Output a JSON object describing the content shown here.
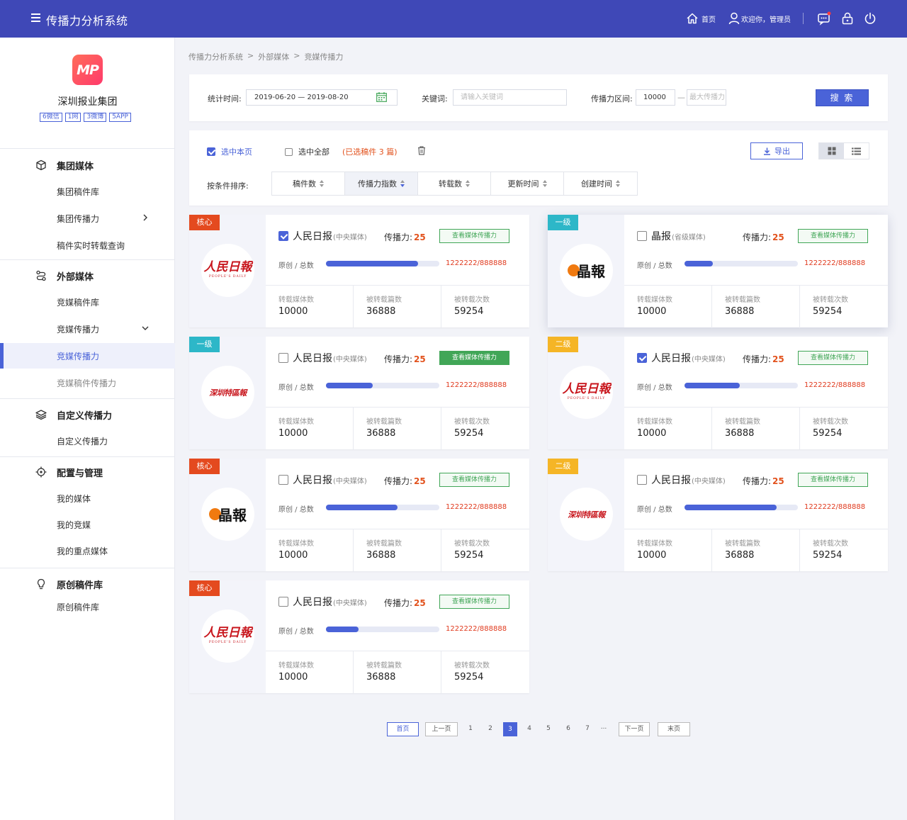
{
  "header": {
    "title": "传播力分析系统",
    "home": "首页",
    "welcome": "欢迎你，管理员"
  },
  "sidebar": {
    "org_name": "深圳报业集团",
    "logo_text": "MP",
    "tags": [
      "6微信",
      "1网",
      "3微博",
      "5APP"
    ],
    "groups": [
      {
        "title": "集团媒体",
        "icon": "cube-icon",
        "items": [
          "集团稿件库",
          "集团传播力",
          "稿件实时转载查询"
        ]
      },
      {
        "title": "外部媒体",
        "icon": "route-icon",
        "items": [
          "竞媒稿件库",
          "竞媒传播力",
          "竞媒传播力",
          "竞媒稿件传播力"
        ]
      },
      {
        "title": "自定义传播力",
        "icon": "layers-icon",
        "items": [
          "自定义传播力"
        ]
      },
      {
        "title": "配置与管理",
        "icon": "target-icon",
        "items": [
          "我的媒体",
          "我的竞媒",
          "我的重点媒体"
        ]
      },
      {
        "title": "原创稿件库",
        "icon": "bulb-icon",
        "items": [
          "原创稿件库"
        ]
      }
    ]
  },
  "breadcrumb": [
    "传播力分析系统",
    "外部媒体",
    "竞媒传播力"
  ],
  "filters": {
    "date_label": "统计时间:",
    "date_value": "2019-06-20 — 2019-08-20",
    "keyword_label": "关键词:",
    "keyword_placeholder": "请输入关键词",
    "range_label": "传播力区间:",
    "range_min": "10000",
    "range_dash": "—",
    "range_max_placeholder": "最大传播力",
    "search_label": "搜 索"
  },
  "toolbar": {
    "select_page": "选中本页",
    "select_all": "选中全部",
    "selected_count": "(已选稿件 3 篇)",
    "export_label": "导出",
    "sort_label": "按条件排序:",
    "sort_options": [
      "稿件数",
      "传播力指数",
      "转载数",
      "更新时间",
      "创建时间"
    ]
  },
  "card_labels": {
    "power": "传播力:",
    "view_btn": "查看媒体传播力",
    "ratio": "原创 / 总数",
    "stat_keys": [
      "转载媒体数",
      "被转载篇数",
      "被转载次数"
    ]
  },
  "cards": [
    {
      "badge": "核心",
      "badge_color": "#e44a1f",
      "logo": "rmrb",
      "checked": true,
      "name": "人民日报",
      "type": "(中央媒体)",
      "power": "25",
      "ratio": "1222222/888888",
      "fill": 0.81,
      "stats": [
        "10000",
        "36888",
        "59254"
      ],
      "btn_solid": false
    },
    {
      "badge": "一级",
      "badge_color": "#2db7c8",
      "logo": "jingbao",
      "checked": false,
      "name": "晶报",
      "type": "(省级媒体)",
      "power": "25",
      "ratio": "1222222/888888",
      "fill": 0.25,
      "stats": [
        "10000",
        "36888",
        "59254"
      ],
      "btn_solid": false
    },
    {
      "badge": "一级",
      "badge_color": "#2db7c8",
      "logo": "sztq",
      "checked": false,
      "name": "人民日报",
      "type": "(中央媒体)",
      "power": "25",
      "ratio": "1222222/888888",
      "fill": 0.41,
      "stats": [
        "10000",
        "36888",
        "59254"
      ],
      "btn_solid": true
    },
    {
      "badge": "二级",
      "badge_color": "#f5b526",
      "logo": "rmrb",
      "checked": true,
      "name": "人民日报",
      "type": "(中央媒体)",
      "power": "25",
      "ratio": "1222222/888888",
      "fill": 0.49,
      "stats": [
        "10000",
        "36888",
        "59254"
      ],
      "btn_solid": false
    },
    {
      "badge": "核心",
      "badge_color": "#e44a1f",
      "logo": "jingbao",
      "checked": false,
      "name": "人民日报",
      "type": "(中央媒体)",
      "power": "25",
      "ratio": "1222222/888888",
      "fill": 0.63,
      "stats": [
        "10000",
        "36888",
        "59254"
      ],
      "btn_solid": false
    },
    {
      "badge": "二级",
      "badge_color": "#f5b526",
      "logo": "sztq",
      "checked": false,
      "name": "人民日报",
      "type": "(中央媒体)",
      "power": "25",
      "ratio": "1222222/888888",
      "fill": 0.81,
      "stats": [
        "10000",
        "36888",
        "59254"
      ],
      "btn_solid": false
    },
    {
      "badge": "核心",
      "badge_color": "#e44a1f",
      "logo": "rmrb",
      "checked": false,
      "name": "人民日报",
      "type": "(中央媒体)",
      "power": "25",
      "ratio": "1222222/888888",
      "fill": 0.29,
      "stats": [
        "10000",
        "36888",
        "59254"
      ],
      "btn_solid": false
    }
  ],
  "logo_text": {
    "rmrb_main": "人民日報",
    "rmrb_sub": "PEOPLE'S DAILY",
    "jingbao": "晶報",
    "sztq": "深圳特區報"
  },
  "pagination": {
    "first": "首页",
    "prev": "上一页",
    "pages": [
      "1",
      "2",
      "3",
      "4",
      "5",
      "6",
      "7",
      "..."
    ],
    "current": "3",
    "next": "下一页",
    "last": "末页"
  },
  "colors": {
    "primary": "#4a63d8",
    "topbar": "#3f48b7",
    "green": "#41a657",
    "red": "#e03a1e"
  }
}
